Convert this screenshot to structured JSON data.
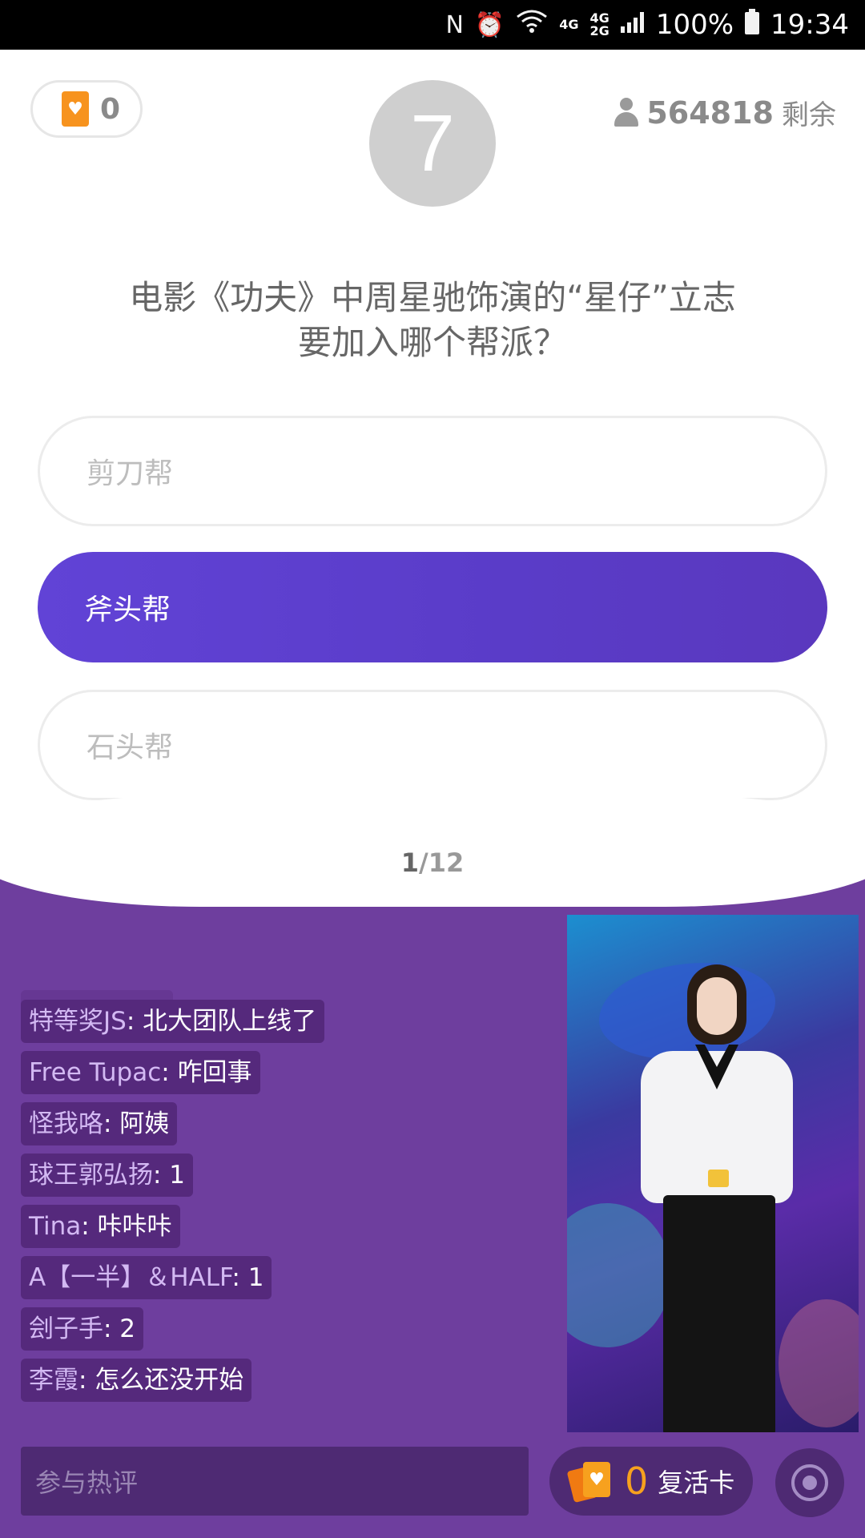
{
  "status_bar": {
    "nfc_icon": "N",
    "alarm_icon": "⏰",
    "wifi_icon": "wifi",
    "network_top": "4G",
    "network_mid": "4G",
    "network_bottom": "2G",
    "battery_percent": "100%",
    "time": "19:34"
  },
  "header": {
    "lives_count": "0",
    "timer": "7",
    "remaining_count": "564818",
    "remaining_suffix": "剩余"
  },
  "question": {
    "text": "电影《功夫》中周星驰饰演的“星仔”立志要加入哪个帮派？"
  },
  "options": [
    {
      "label": "剪刀帮",
      "selected": false
    },
    {
      "label": "斧头帮",
      "selected": true
    },
    {
      "label": "石头帮",
      "selected": false
    }
  ],
  "progress": {
    "current": "1",
    "total": "/12"
  },
  "chat": [
    {
      "user": "特等奖JS",
      "msg": ": 北大团队上线了"
    },
    {
      "user": "Free Tupac",
      "msg": ": 咋回事"
    },
    {
      "user": "怪我咯",
      "msg": ": 阿姨"
    },
    {
      "user": "球王郭弘扬",
      "msg": ": 1"
    },
    {
      "user": "Tina",
      "msg": ": 咔咔咔"
    },
    {
      "user": "A【一半】＆HALF",
      "msg": ": 1"
    },
    {
      "user": "刽子手",
      "msg": ": 2"
    },
    {
      "user": "李霞",
      "msg": ": 怎么还没开始"
    }
  ],
  "bottom": {
    "comment_placeholder": "参与热评",
    "revive_count": "0",
    "revive_label": "复活卡"
  },
  "colors": {
    "accent_purple": "#5a3cc8",
    "background_purple": "#6e3e9e",
    "orange": "#f7931e"
  }
}
